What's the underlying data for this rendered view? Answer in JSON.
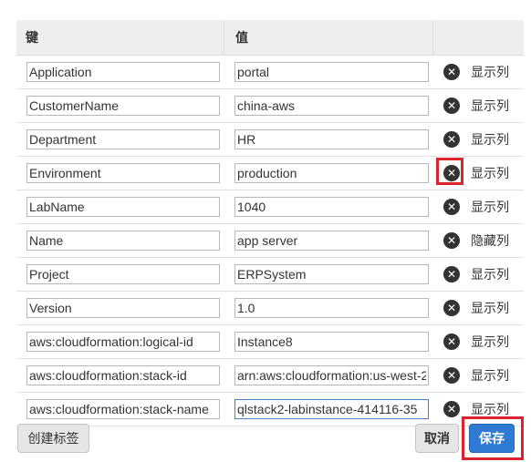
{
  "header": {
    "key_label": "键",
    "value_label": "值"
  },
  "tags": [
    {
      "key": "Application",
      "value": "portal",
      "visibility": "显示列"
    },
    {
      "key": "CustomerName",
      "value": "china-aws",
      "visibility": "显示列"
    },
    {
      "key": "Department",
      "value": "HR",
      "visibility": "显示列"
    },
    {
      "key": "Environment",
      "value": "production",
      "visibility": "显示列"
    },
    {
      "key": "LabName",
      "value": "1040",
      "visibility": "显示列"
    },
    {
      "key": "Name",
      "value": "app server",
      "visibility": "隐藏列"
    },
    {
      "key": "Project",
      "value": "ERPSystem",
      "visibility": "显示列"
    },
    {
      "key": "Version",
      "value": "1.0",
      "visibility": "显示列"
    },
    {
      "key": "aws:cloudformation:logical-id",
      "value": "Instance8",
      "visibility": "显示列"
    },
    {
      "key": "aws:cloudformation:stack-id",
      "value": "arn:aws:cloudformation:us-west-2",
      "visibility": "显示列"
    },
    {
      "key": "aws:cloudformation:stack-name",
      "value": "qlstack2-labinstance-414116-35",
      "visibility": "显示列"
    }
  ],
  "icons": {
    "delete": "close-circle-icon"
  },
  "buttons": {
    "create_tag": "创建标签",
    "cancel": "取消",
    "save": "保存"
  },
  "colors": {
    "save_button": "#2f7bd3",
    "highlight_border": "#d9232d",
    "header_bg": "#eeeeee"
  }
}
